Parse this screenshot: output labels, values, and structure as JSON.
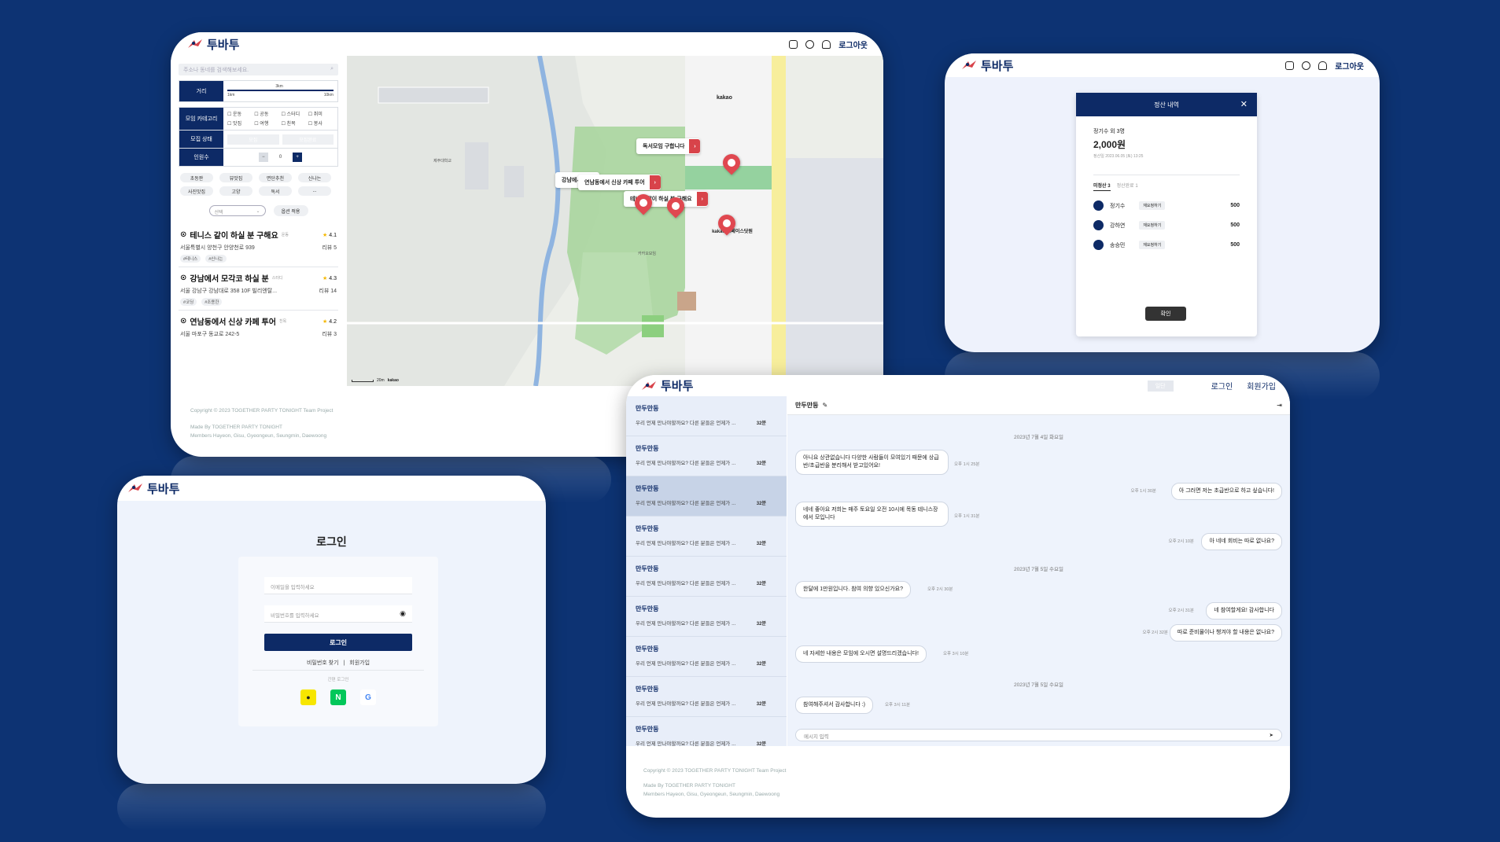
{
  "brand": {
    "name": "투바투"
  },
  "map_window": {
    "logout": "로그아웃",
    "search_placeholder": "주소나 동네를 검색해보세요.",
    "filters": {
      "distance_label": "거리",
      "distance_ticks": [
        "1km",
        "3km",
        "10km"
      ],
      "category_label": "모임 카테고리",
      "categories": [
        "운동",
        "공동",
        "스터디",
        "취미",
        "맛집",
        "여행",
        "친목",
        "봉사"
      ],
      "status_label": "모집 상태",
      "status_options": [
        "모집",
        "모집완료"
      ],
      "people_label": "인원수",
      "people_value": "0"
    },
    "chips": [
      "초동판",
      "뷰맛집",
      "면단추천",
      "신나는",
      "사진맛집",
      "고양",
      "독서",
      "..."
    ],
    "select_placeholder": "선택",
    "select_button": "옵션 적용",
    "cards": [
      {
        "title": "테니스 같이 하실 분 구해요",
        "tag": "운동",
        "rating": "4.1",
        "address": "서울특별시 양천구 안양천로 939",
        "reviews": "리뷰 5",
        "tags": [
          "#테니스",
          "#신나는"
        ]
      },
      {
        "title": "강남에서 모각코 하실 분",
        "tag": "스터디",
        "rating": "4.3",
        "address": "서울 강남구 강남대로 358 10F 빌리엔탈...",
        "reviews": "리뷰 14",
        "tags": [
          "#코딩",
          "#조용한"
        ]
      },
      {
        "title": "연남동에서 신상 카페 투어",
        "tag": "친목",
        "rating": "4.2",
        "address": "서울 마포구 동교로 242-5",
        "reviews": "리뷰 3",
        "tags": []
      }
    ],
    "map_bubbles": [
      "독서모임 구합니다",
      "연남동에서 신상 카페 투어",
      "강남에서 모...",
      "테니스 같이 하실 분 구해요"
    ],
    "map_labels": [
      "kakao",
      "카카오모임",
      "제주대학교",
      "kakao 스페이스닷원"
    ],
    "map_scale": "20m",
    "map_provider": "kakao",
    "footer": [
      "Copyright © 2023 TOGETHER PARTY TONIGHT Team Project",
      "Made By TOGETHER PARTY TONIGHT",
      "Members Hayeon, Gisu, Gyeongeun, Seungmin, Daewoong"
    ]
  },
  "settle_window": {
    "logout": "로그아웃",
    "modal_title": "정산 내역",
    "summary_sub": "정기수 외 3명",
    "amount": "2,000원",
    "date": "정산일 2023.06.05 (토) 13:25",
    "tab_active": "미정산 3",
    "tab_inactive": "정산완료 1",
    "people": [
      {
        "name": "정기수",
        "btn": "재요청하기",
        "amount": "500"
      },
      {
        "name": "강하연",
        "btn": "재요청하기",
        "amount": "500"
      },
      {
        "name": "송승민",
        "btn": "재요청하기",
        "amount": "500"
      }
    ],
    "confirm": "확인"
  },
  "login_window": {
    "title": "로그인",
    "email_placeholder": "이메일을 입력하세요",
    "password_placeholder": "비밀번호를 입력하세요",
    "login_button": "로그인",
    "find_password": "비밀번호 찾기",
    "separator": "|",
    "signup": "회원가입",
    "simple_login": "간편 로그인"
  },
  "chat_window": {
    "nav_login": "로그인",
    "nav_signup": "회원가입",
    "nav_ghost": "일단",
    "room_title": "만두만둥",
    "rooms": [
      {
        "name": "만두만둥",
        "msg": "우리 언제 만나야할까요? 다른 분들은 언제가 ...",
        "time": "32분"
      },
      {
        "name": "만두만둥",
        "msg": "우리 언제 만나야할까요? 다른 분들은 언제가 ...",
        "time": "32분"
      },
      {
        "name": "만두만둥",
        "msg": "우리 언제 만나야할까요? 다른 분들은 언제가 ...",
        "time": "32분"
      },
      {
        "name": "만두만둥",
        "msg": "우리 언제 만나야할까요? 다른 분들은 언제가 ...",
        "time": "32분"
      },
      {
        "name": "만두만둥",
        "msg": "우리 언제 만나야할까요? 다른 분들은 언제가 ...",
        "time": "32분"
      },
      {
        "name": "만두만둥",
        "msg": "우리 언제 만나야할까요? 다른 분들은 언제가 ...",
        "time": "32분"
      },
      {
        "name": "만두만둥",
        "msg": "우리 언제 만나야할까요? 다른 분들은 언제가 ...",
        "time": "32분"
      },
      {
        "name": "만두만둥",
        "msg": "우리 언제 만나야할까요? 다른 분들은 언제가 ...",
        "time": "32분"
      },
      {
        "name": "만두만둥",
        "msg": "우리 언제 만나야할까요? 다른 분들은 언제가 ...",
        "time": "32분"
      }
    ],
    "dates": [
      "2023년 7월 4일 화요일",
      "2023년 7월 5일 수요일",
      "2023년 7월 5일 수요일"
    ],
    "messages": [
      {
        "text": "아니요 상관없습니다 다양한 사람들이 모여있기 때문에 상급반/초급반을 분리해서 받고있어요!",
        "time": "오후 1시 25분"
      },
      {
        "text": "아 그러면 저는 초급반으로 하고 싶습니다!",
        "time": "오후 1시 30분"
      },
      {
        "text": "네네 좋아요 저희는 매주 토요일 오전 10시에 목동 테니스장에서 모입니다",
        "time": "오후 1시 31분"
      },
      {
        "text": "아 네네 회비는 따로 없나요?",
        "time": "오후 2시 10분"
      },
      {
        "text": "한달에 1만원입니다. 참여 의향 있으신가요?",
        "time": "오후 2시 30분"
      },
      {
        "text": "네 참여할게요! 감사합니다",
        "time": "오후 2시 31분"
      },
      {
        "text": "따로 준비물이나 챙겨야 할 내용은 없나요?",
        "time": "오후 2시 32분"
      },
      {
        "text": "네 자세한 내용은 모임에 오시면 설명드리겠습니다!",
        "time": "오후 3시 10분"
      },
      {
        "text": "참여해주셔서 감사합니다 :)",
        "time": "오후 3시 11분"
      }
    ],
    "input_placeholder": "메시지 입력",
    "footer": [
      "Copyright © 2023 TOGETHER PARTY TONIGHT Team Project",
      "Made By TOGETHER PARTY TONIGHT",
      "Members Hayeon, Gisu, Gyeongeun, Seungmin, Daewoong"
    ]
  },
  "colors": {
    "navy": "#0d2a66",
    "background": "#0d3373",
    "pin": "#e04850",
    "kakao_yellow": "#f7e600",
    "naver_green": "#03c75a"
  }
}
